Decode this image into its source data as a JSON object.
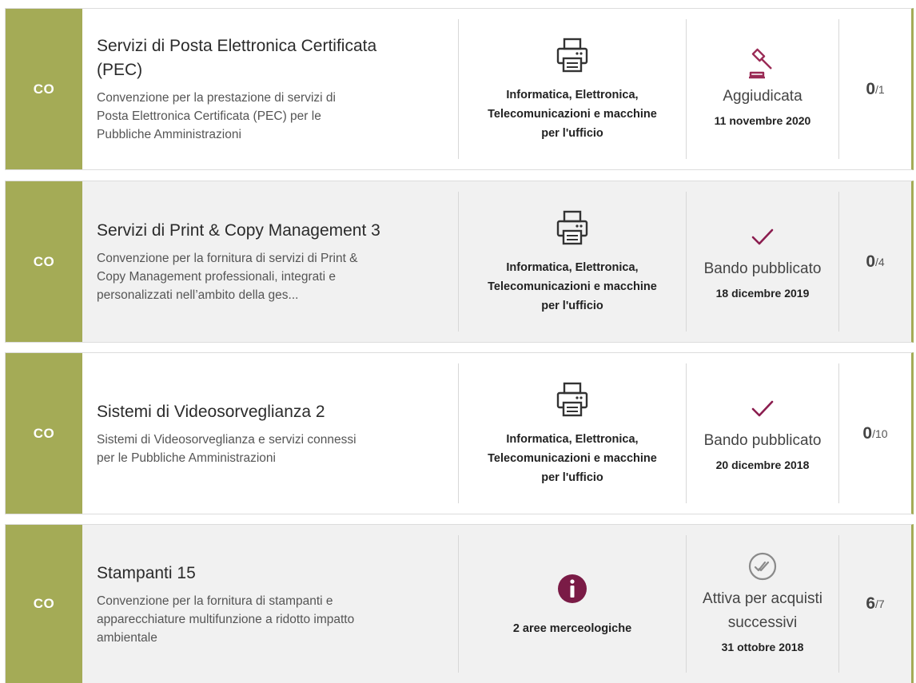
{
  "colors": {
    "accent": "#a4ab56",
    "status_icon": "#8b1d4f",
    "info_badge": "#7a1b46"
  },
  "rows": [
    {
      "badge": "CO",
      "title_lines": [
        "Servizi di Posta Elettronica Certificata",
        "(PEC)"
      ],
      "desc_lines": [
        "Convenzione per la prestazione di servizi di",
        "Posta Elettronica Certificata (PEC) per le",
        "Pubbliche Amministrazioni"
      ],
      "category_icon": "printer-icon",
      "category_lines": [
        "Informatica, Elettronica,",
        "Telecomunicazioni e macchine",
        "per l'ufficio"
      ],
      "status_icon": "gavel-icon",
      "status_lines": [
        "Aggiudicata"
      ],
      "status_date": "11 novembre 2020",
      "count": "0",
      "count_total": "/1"
    },
    {
      "badge": "CO",
      "title_lines": [
        "Servizi di Print & Copy Management 3"
      ],
      "desc_lines": [
        "Convenzione per la fornitura di servizi di Print &",
        "Copy Management professionali, integrati e",
        "personalizzati nell’ambito della ges..."
      ],
      "category_icon": "printer-icon",
      "category_lines": [
        "Informatica, Elettronica,",
        "Telecomunicazioni e macchine",
        "per l'ufficio"
      ],
      "status_icon": "check-icon",
      "status_lines": [
        "Bando pubblicato"
      ],
      "status_date": "18 dicembre 2019",
      "count": "0",
      "count_total": "/4"
    },
    {
      "badge": "CO",
      "title_lines": [
        "Sistemi di Videosorveglianza 2"
      ],
      "desc_lines": [
        "Sistemi di Videosorveglianza e servizi connessi",
        "per le Pubbliche Amministrazioni"
      ],
      "category_icon": "printer-icon",
      "category_lines": [
        "Informatica, Elettronica,",
        "Telecomunicazioni e macchine",
        "per l'ufficio"
      ],
      "status_icon": "check-icon",
      "status_lines": [
        "Bando pubblicato"
      ],
      "status_date": "20 dicembre 2018",
      "count": "0",
      "count_total": "/10"
    },
    {
      "badge": "CO",
      "title_lines": [
        "Stampanti 15"
      ],
      "desc_lines": [
        "Convenzione per la fornitura di stampanti e",
        "apparecchiature multifunzione a ridotto impatto",
        "ambientale"
      ],
      "category_icon": "info-icon",
      "category_lines": [
        "2 aree merceologiche"
      ],
      "status_icon": "double-check-circle-icon",
      "status_lines": [
        "Attiva per acquisti",
        "successivi"
      ],
      "status_date": "31 ottobre 2018",
      "count": "6",
      "count_total": "/7"
    }
  ]
}
